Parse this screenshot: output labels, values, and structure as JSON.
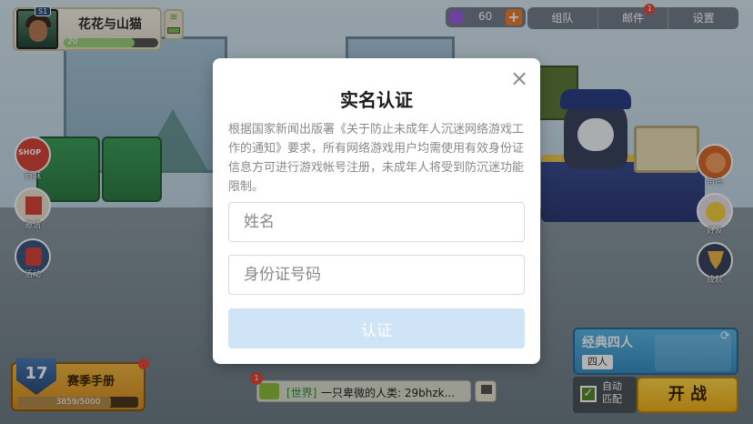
{
  "player": {
    "name": "花花与山猫",
    "rank_badge": "S1",
    "level": "20",
    "level_progress": 0.75
  },
  "currency": {
    "gem_count": "60",
    "add_label": "+"
  },
  "top_menu": {
    "items": [
      "组队",
      "邮件",
      "设置"
    ],
    "mail_badge": "1"
  },
  "side_left": {
    "shop_badge": "SHOP",
    "items": [
      "商城",
      "邀请",
      "活动"
    ]
  },
  "side_right": {
    "items": [
      "角色",
      "好友",
      "成就"
    ]
  },
  "season": {
    "level": "17",
    "title": "赛季手册",
    "progress_text": "3859/5000",
    "progress": 0.7718
  },
  "chat": {
    "badge": "1",
    "channel": "[世界]",
    "message": "一只卑微的人类: 29bhzk..."
  },
  "mode": {
    "title": "经典四人",
    "sub": "四人",
    "auto_label": "自动匹配",
    "auto_checked": "✓",
    "start_label": "开 战",
    "refresh_icon": "⟳"
  },
  "modal": {
    "title": "实名认证",
    "close_icon": "×",
    "notice": "根据国家新闻出版署《关于防止未成年人沉迷网络游戏工作的通知》要求，所有网络游戏用户均需使用有效身份证信息方可进行游戏帐号注册，未成年人将受到防沉迷功能限制。",
    "name_placeholder": "姓名",
    "id_placeholder": "身份证号码",
    "submit_label": "认证"
  },
  "colors": {
    "submit_bg": "#cfe4f6",
    "start_bg": "#f2b11a",
    "accent_orange": "#ef7f2a"
  }
}
